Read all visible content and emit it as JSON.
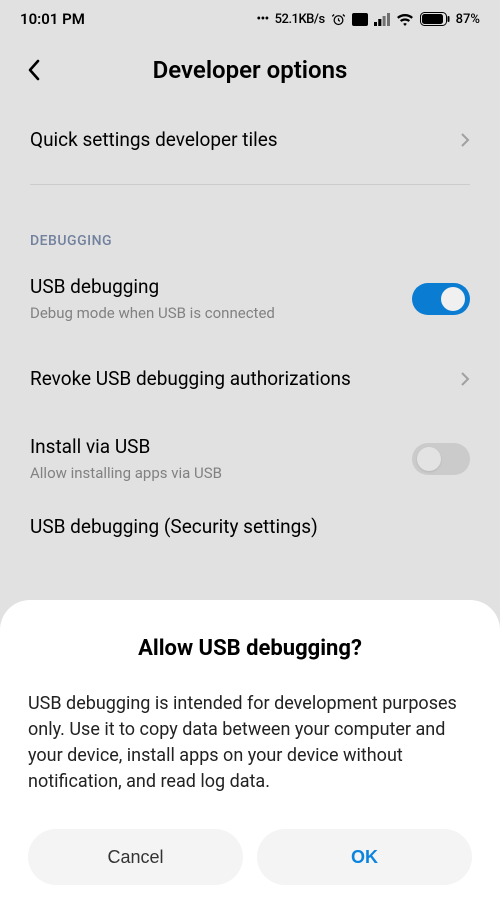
{
  "status": {
    "time": "10:01 PM",
    "net_speed": "52.1KB/s",
    "battery_pct": "87%"
  },
  "header": {
    "title": "Developer options"
  },
  "rows": {
    "quick_tiles": {
      "title": "Quick settings developer tiles"
    },
    "debug_section": "DEBUGGING",
    "usb_debug": {
      "title": "USB debugging",
      "sub": "Debug mode when USB is connected",
      "enabled": true
    },
    "revoke": {
      "title": "Revoke USB debugging authorizations"
    },
    "install_usb": {
      "title": "Install via USB",
      "sub": "Allow installing apps via USB",
      "enabled": false
    },
    "cutoff": "USB debugging (Security settings)"
  },
  "dialog": {
    "title": "Allow USB debugging?",
    "body": "USB debugging is intended for development purposes only. Use it to copy data between your computer and your device, install apps on your device without notification, and read log data.",
    "cancel": "Cancel",
    "ok": "OK"
  }
}
